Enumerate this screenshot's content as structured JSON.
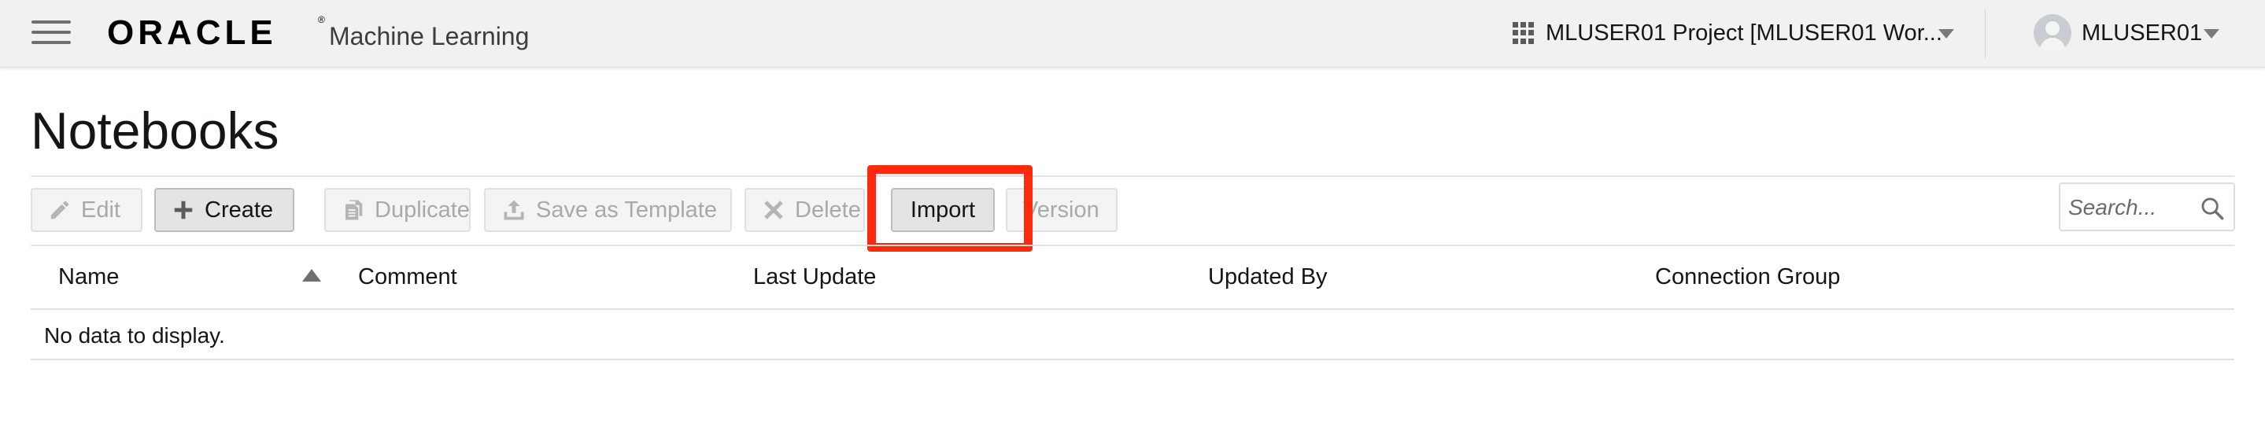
{
  "header": {
    "brand": "ORACLE",
    "brand_mark": "®",
    "product": "Machine Learning",
    "project_label": "MLUSER01 Project [MLUSER01 Wor...",
    "user_label": "MLUSER01"
  },
  "page": {
    "title": "Notebooks"
  },
  "toolbar": {
    "edit_label": "Edit",
    "create_label": "Create",
    "duplicate_label": "Duplicate",
    "save_template_label": "Save as Template",
    "delete_label": "Delete",
    "import_label": "Import",
    "version_label": "Version"
  },
  "search": {
    "placeholder": "Search..."
  },
  "table": {
    "columns": [
      "Name",
      "Comment",
      "Last Update",
      "Updated By",
      "Connection Group"
    ],
    "sorted_column": "Name",
    "sort_direction": "ascending",
    "rows": [],
    "empty_message": "No data to display."
  },
  "colors": {
    "highlight": "#ff2a0d",
    "header_bg": "#f1f1f1"
  }
}
